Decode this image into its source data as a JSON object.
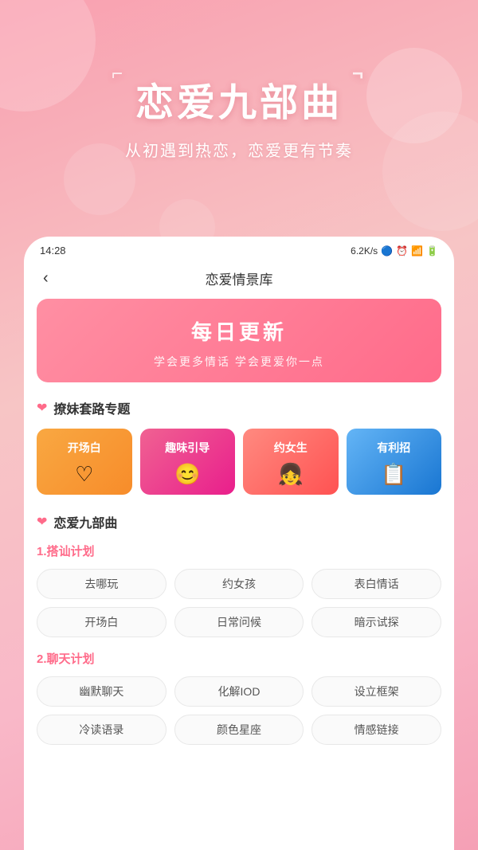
{
  "background": {
    "gradient_start": "#f9a0b0",
    "gradient_end": "#f5a0b5"
  },
  "hero": {
    "title": "恋爱九部曲",
    "subtitle": "从初遇到热恋，恋爱更有节奏"
  },
  "status_bar": {
    "time": "14:28",
    "network": "6.2K/s",
    "icons": "🔵 ⏰ 📷 📶"
  },
  "nav": {
    "back_icon": "‹",
    "title": "恋爱情景库"
  },
  "banner": {
    "title": "每日更新",
    "subtitle": "学会更多情话  学会更爱你一点"
  },
  "topic_section": {
    "heart": "❤",
    "title": "撩妹套路专题"
  },
  "categories": [
    {
      "label": "开场白",
      "icon": "♡",
      "color_class": "cat-orange"
    },
    {
      "label": "趣味引导",
      "icon": "😊",
      "color_class": "cat-pink"
    },
    {
      "label": "约女生",
      "icon": "👧",
      "color_class": "cat-salmon"
    },
    {
      "label": "有利招",
      "icon": "📋",
      "color_class": "cat-blue"
    }
  ],
  "nine_section": {
    "heart": "❤",
    "title": "恋爱九部曲"
  },
  "plans": [
    {
      "label": "1.搭讪计划",
      "tags": [
        "去哪玩",
        "约女孩",
        "表白情话",
        "开场白",
        "日常问候",
        "暗示试探"
      ]
    },
    {
      "label": "2.聊天计划",
      "tags": [
        "幽默聊天",
        "化解IOD",
        "设立框架",
        "冷读语录",
        "颜色星座",
        "情感链接"
      ]
    }
  ]
}
